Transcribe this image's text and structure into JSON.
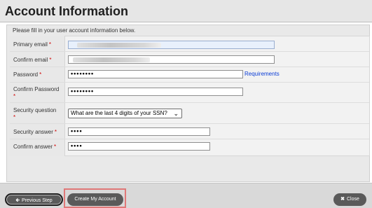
{
  "header": {
    "title": "Account Information"
  },
  "form": {
    "instructions": "Please fill in your user account information below.",
    "primary_email_label": "Primary email",
    "confirm_email_label": "Confirm email",
    "password_label": "Password",
    "password_value": "••••••••",
    "requirements_link": "Requirements",
    "confirm_password_label": "Confirm Password",
    "confirm_password_value": "••••••••",
    "security_question_label": "Security question",
    "security_question_value": "What are the last 4 digits of your SSN?",
    "security_answer_label": "Security answer",
    "security_answer_value": "••••",
    "confirm_answer_label": "Confirm answer",
    "confirm_answer_value": "••••",
    "required_mark": "*"
  },
  "footer": {
    "previous_label": "Previous Step",
    "create_label": "Create My Account",
    "close_label": "Close"
  },
  "icons": {
    "previous": "arrow-left-icon",
    "close": "x-icon",
    "dropdown": "chevron-down-icon"
  },
  "colors": {
    "required": "#d00000",
    "link": "#0b3dd6",
    "button": "#5a5a5a",
    "highlight": "#e07878"
  }
}
